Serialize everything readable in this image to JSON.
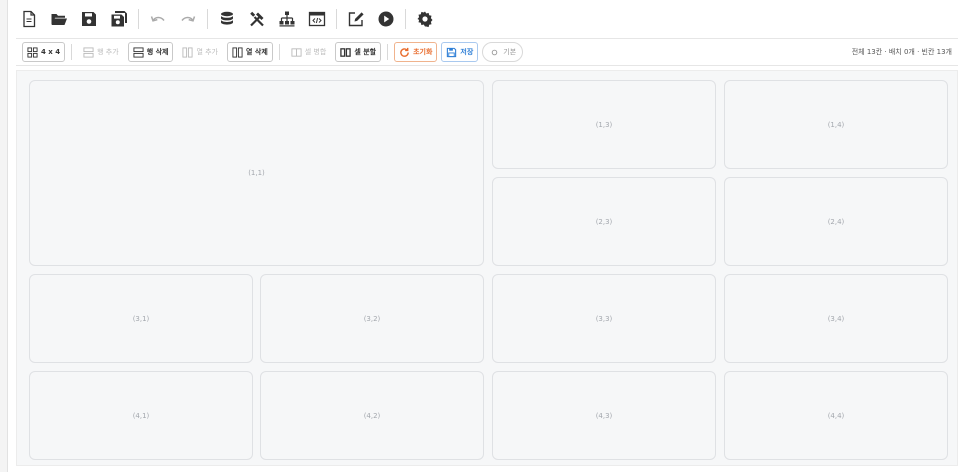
{
  "toolbar": {
    "icons": [
      "new-file-icon",
      "open-folder-icon",
      "save-icon",
      "save-all-icon",
      "undo-icon",
      "redo-icon",
      "database-icon",
      "tools-icon",
      "hierarchy-icon",
      "code-window-icon",
      "edit-icon",
      "play-icon",
      "settings-icon"
    ]
  },
  "grid_toolbar": {
    "layout_label": "4 x 4",
    "add_row_label": "행 추가",
    "delete_row_label": "행 삭제",
    "add_col_label": "열 추가",
    "delete_col_label": "열 삭제",
    "merge_label": "셀 병합",
    "split_label": "셀 분할",
    "reset_label": "초기화",
    "save_label": "저장",
    "default_label": "기본",
    "status": "전체 13칸 · 배치 0개 · 빈칸 13개"
  },
  "cells": {
    "c11": "(1,1)",
    "c13": "(1,3)",
    "c14": "(1,4)",
    "c23": "(2,3)",
    "c24": "(2,4)",
    "c31": "(3,1)",
    "c32": "(3,2)",
    "c33": "(3,3)",
    "c34": "(3,4)",
    "c41": "(4,1)",
    "c42": "(4,2)",
    "c43": "(4,3)",
    "c44": "(4,4)"
  },
  "colors": {
    "reset_accent": "#e86a2a",
    "save_accent": "#2f7fd6",
    "cell_bg": "#f6f7f8",
    "cell_border": "#dfe1e4"
  }
}
